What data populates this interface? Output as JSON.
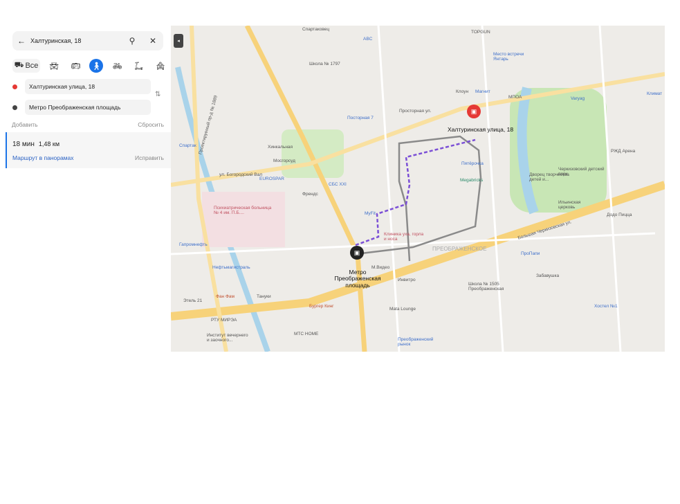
{
  "search": {
    "value": "Халтуринская, 18"
  },
  "modes": {
    "all_label": "Все"
  },
  "route_points": [
    {
      "label": "Халтуринская улица, 18",
      "color": "#e53935"
    },
    {
      "label": "Метро Преображенская площадь",
      "color": "#444444"
    }
  ],
  "actions": {
    "add": "Добавить",
    "reset": "Сбросить"
  },
  "result": {
    "time": "18 мин",
    "distance": "1,48 км",
    "panorama_link": "Маршрут в панорамах",
    "fix": "Исправить"
  },
  "map": {
    "destination": "Халтуринская улица, 18",
    "origin": "Метро Преображенская площадь",
    "labels": [
      "Спартаковец",
      "ABC",
      "TOPGUN",
      "Место встречи Янтарь",
      "Школа № 1797",
      "Клоун",
      "Магнит",
      "МПОА",
      "Климат",
      "Varyag",
      "Посторная 7",
      "Просторная ул.",
      "Спартак",
      "Хинкальная",
      "Мосгорсуд",
      "ул. Богородский Вал",
      "EUROSPAR",
      "СБС XXI",
      "Френдс",
      "Пятёрочка",
      "Megabricks",
      "Дворец творчества детей и...",
      "Черкизовский детский парк",
      "РЖД Арена",
      "Ильинская церковь",
      "Большая Черкизовская ул.",
      "Додо Пицца",
      "Психиатрическая больница № 4 им. П.Б....",
      "MyFit",
      "Клиника уха, горла и носа",
      "ПРЕОБРАЖЕНСКОЕ",
      "Гапромнефть",
      "Нефтьмагистраль",
      "М.Видео",
      "Инвитро",
      "Школа № 1505 Преображенская",
      "ПроПапи",
      "Забавушка",
      "Хостел №1",
      "Фан Фам",
      "Тануки",
      "Бургер Кинг",
      "Этель 21",
      "РТУ МИРЭА",
      "МТС HOME",
      "Mata Lounge",
      "Преображенский рынок",
      "Институт вечернего и заочного...",
      "Проектируемый пр-д № 1889"
    ],
    "colors": {
      "route_walk": "#7b4fd6",
      "route_alt": "#8a8a8a",
      "road_major": "#f7d27a",
      "park": "#c8e6b5",
      "water": "#a9d3ea"
    }
  }
}
